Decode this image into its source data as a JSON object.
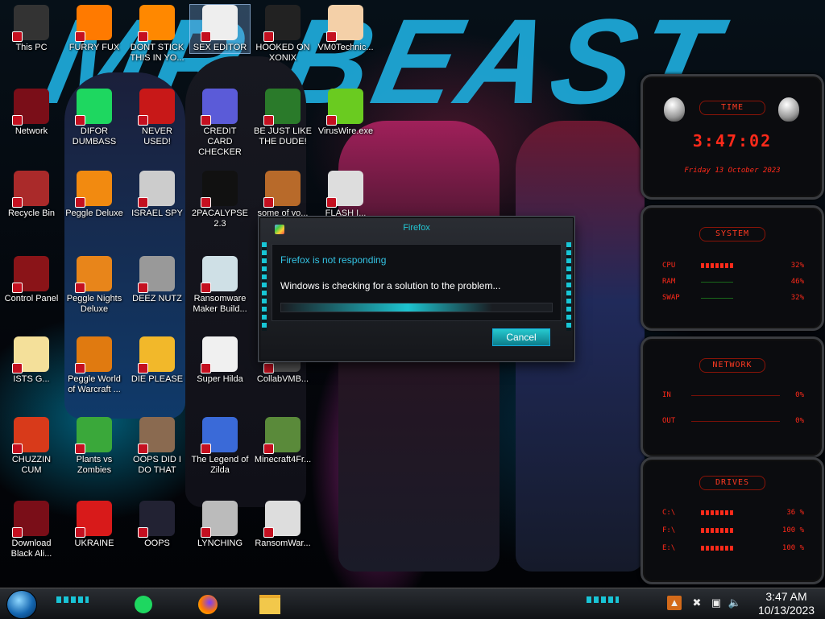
{
  "desktop": {
    "wallpaper_text": "MR BEAST",
    "icons": [
      {
        "label": "This PC"
      },
      {
        "label": "FURRY FUX"
      },
      {
        "label": "DONT STICK THIS IN YO..."
      },
      {
        "label": "SEX EDITOR"
      },
      {
        "label": "HOOKED ON XONIX"
      },
      {
        "label": "VM0Technic..."
      },
      {
        "label": "Network"
      },
      {
        "label": "DIFOR DUMBASS"
      },
      {
        "label": "NEVER USED!"
      },
      {
        "label": "CREDIT CARD CHECKER"
      },
      {
        "label": "BE JUST LIKE THE DUDE!"
      },
      {
        "label": "VirusWire.exe"
      },
      {
        "label": "Recycle Bin"
      },
      {
        "label": "Peggle Deluxe"
      },
      {
        "label": "ISRAEL SPY"
      },
      {
        "label": "2PACALYPSE 2.3"
      },
      {
        "label": "some of yo..."
      },
      {
        "label": "FLASH I..."
      },
      {
        "label": "Control Panel"
      },
      {
        "label": "Peggle Nights Deluxe"
      },
      {
        "label": "DEEZ NUTZ"
      },
      {
        "label": "Ransomware Maker Build..."
      },
      {
        "label": "ISTS G..."
      },
      {
        "label": "Peggle World of Warcraft ..."
      },
      {
        "label": "DIE PLEASE"
      },
      {
        "label": "Super Hilda"
      },
      {
        "label": "CollabVMB..."
      },
      {
        "label": "CHUZZIN CUM"
      },
      {
        "label": "Plants vs Zombies"
      },
      {
        "label": "OOPS DID I DO THAT"
      },
      {
        "label": "The Legend of Zilda"
      },
      {
        "label": "Minecraft4Fr..."
      },
      {
        "label": "Download Black Ali..."
      },
      {
        "label": "UKRAINE"
      },
      {
        "label": "OOPS"
      },
      {
        "label": "LYNCHING"
      },
      {
        "label": "RansomWar..."
      }
    ],
    "icon_glyphs": [
      "monitor-icon",
      "firefox-icon",
      "vlc-cone-icon",
      "xd-icon",
      "xonix-icon",
      "doctor-icon",
      "network-orb-icon",
      "spotify-icon",
      "dev-cpp-icon",
      "credit-card-icon",
      "santa-icon",
      "lime-icon",
      "recycle-bin-icon",
      "peggle-icon",
      "scanner-icon",
      "terminal-icon",
      "beaver-icon",
      "flash-icon",
      "control-panel-icon",
      "peggle-nights-icon",
      "stack-icon",
      "ransomware-window-icon",
      "cartoon-girl-icon",
      "peggle-wow-icon",
      "die-icon",
      "pixel-dog-icon",
      "collabvm-icon",
      "chuzzle-icon",
      "plants-icon",
      "portrait-icon",
      "pixel-hero-icon",
      "minecraft-block-icon",
      "alien-orb-icon",
      "radiation-icon",
      "monitor-dark-icon",
      "lynching-icon",
      "skull-icon"
    ]
  },
  "dialog": {
    "title": "Firefox",
    "heading": "Firefox is not responding",
    "message": "Windows is checking for a solution to the problem...",
    "cancel_label": "Cancel",
    "progress": 0.78
  },
  "gadgets": {
    "time": {
      "label": "TIME",
      "clock": "3:47:02",
      "date": "Friday 13 October 2023"
    },
    "system": {
      "label": "SYSTEM",
      "rows": [
        {
          "key": "CPU",
          "value": "32%"
        },
        {
          "key": "RAM",
          "value": "46%"
        },
        {
          "key": "SWAP",
          "value": "32%"
        }
      ]
    },
    "network": {
      "label": "NETWORK",
      "rows": [
        {
          "key": "IN",
          "value": "0%"
        },
        {
          "key": "OUT",
          "value": "0%"
        }
      ]
    },
    "drives": {
      "label": "DRIVES",
      "rows": [
        {
          "key": "C:\\",
          "value": "36 %"
        },
        {
          "key": "F:\\",
          "value": "100 %"
        },
        {
          "key": "E:\\",
          "value": "100 %"
        }
      ]
    }
  },
  "taskbar": {
    "pinned": [
      "spotify-icon",
      "firefox-icon",
      "file-explorer-icon"
    ],
    "tray": [
      "up-arrow-icon",
      "network-off-icon",
      "network-icon",
      "volume-icon"
    ],
    "clock_time": "3:47 AM",
    "clock_date": "10/13/2023"
  },
  "colors": {
    "accent_cyan": "#1ec6d6",
    "gadget_red": "#ff2a1a"
  }
}
